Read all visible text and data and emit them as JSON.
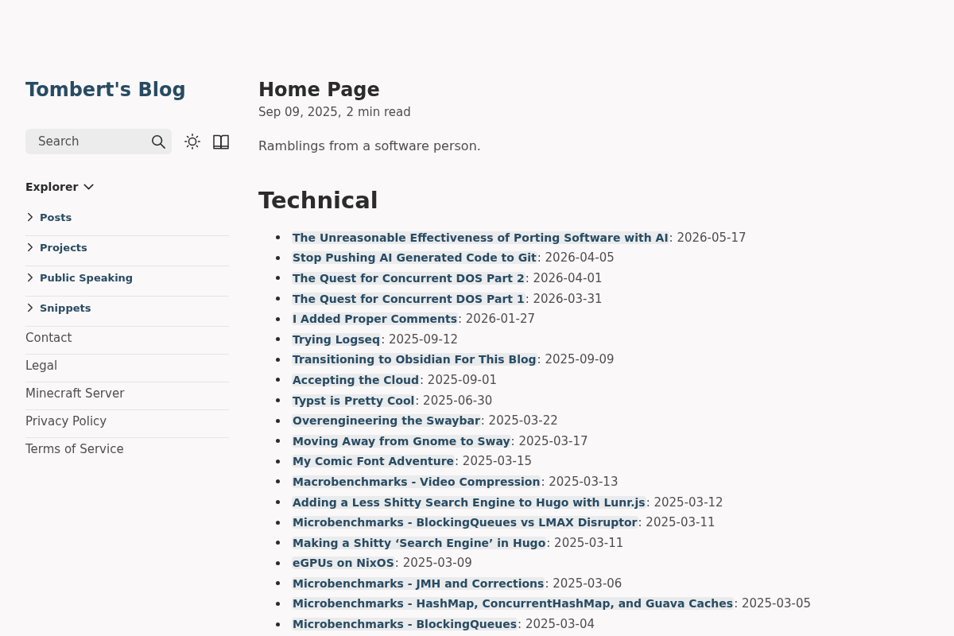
{
  "site_title": "Tombert's Blog",
  "search": {
    "placeholder": "Search"
  },
  "explorer": {
    "label": "Explorer",
    "expanded": true,
    "items": [
      {
        "kind": "folder",
        "label": "Posts",
        "expanded": false
      },
      {
        "kind": "folder",
        "label": "Projects",
        "expanded": false
      },
      {
        "kind": "folder",
        "label": "Public Speaking",
        "expanded": false
      },
      {
        "kind": "folder",
        "label": "Snippets",
        "expanded": false
      },
      {
        "kind": "page",
        "label": "Contact"
      },
      {
        "kind": "page",
        "label": "Legal"
      },
      {
        "kind": "page",
        "label": "Minecraft Server"
      },
      {
        "kind": "page",
        "label": "Privacy Policy"
      },
      {
        "kind": "page",
        "label": "Terms of Service"
      }
    ]
  },
  "page": {
    "title": "Home Page",
    "meta": [
      "Sep 09, 2025,",
      "2 min read"
    ],
    "description": "Ramblings from a software person.",
    "sections": [
      {
        "heading": "Technical",
        "posts": [
          {
            "title": "The Unreasonable Effectiveness of Porting Software with AI",
            "suffix": ": 2026-05-17"
          },
          {
            "title": "Stop Pushing AI Generated Code to Git",
            "suffix": ": 2026-04-05"
          },
          {
            "title": "The Quest for Concurrent DOS Part 2",
            "suffix": ": 2026-04-01"
          },
          {
            "title": "The Quest for Concurrent DOS Part 1",
            "suffix": ": 2026-03-31"
          },
          {
            "title": "I Added Proper Comments",
            "suffix": ": 2026-01-27"
          },
          {
            "title": "Trying Logseq",
            "suffix": ": 2025-09-12"
          },
          {
            "title": "Transitioning to Obsidian For This Blog",
            "suffix": ": 2025-09-09"
          },
          {
            "title": "Accepting the Cloud",
            "suffix": ": 2025-09-01"
          },
          {
            "title": "Typst is Pretty Cool",
            "suffix": ": 2025-06-30"
          },
          {
            "title": "Overengineering the Swaybar",
            "suffix": ": 2025-03-22"
          },
          {
            "title": "Moving Away from Gnome to Sway",
            "suffix": ": 2025-03-17"
          },
          {
            "title": "My Comic Font Adventure",
            "suffix": ": 2025-03-15"
          },
          {
            "title": "Macrobenchmarks - Video Compression",
            "suffix": ": 2025-03-13"
          },
          {
            "title": "Adding a Less Shitty Search Engine to Hugo with Lunr.js",
            "suffix": ": 2025-03-12"
          },
          {
            "title": "Microbenchmarks - BlockingQueues vs LMAX Disruptor",
            "suffix": ": 2025-03-11"
          },
          {
            "title": "Making a Shitty ‘Search Engine’ in Hugo",
            "suffix": ": 2025-03-11"
          },
          {
            "title": "eGPUs on NixOS",
            "suffix": ": 2025-03-09"
          },
          {
            "title": "Microbenchmarks - JMH and Corrections",
            "suffix": ": 2025-03-06"
          },
          {
            "title": "Microbenchmarks - HashMap, ConcurrentHashMap, and Guava Caches",
            "suffix": ": 2025-03-05"
          },
          {
            "title": "Microbenchmarks - BlockingQueues",
            "suffix": ": 2025-03-04"
          }
        ]
      }
    ]
  }
}
